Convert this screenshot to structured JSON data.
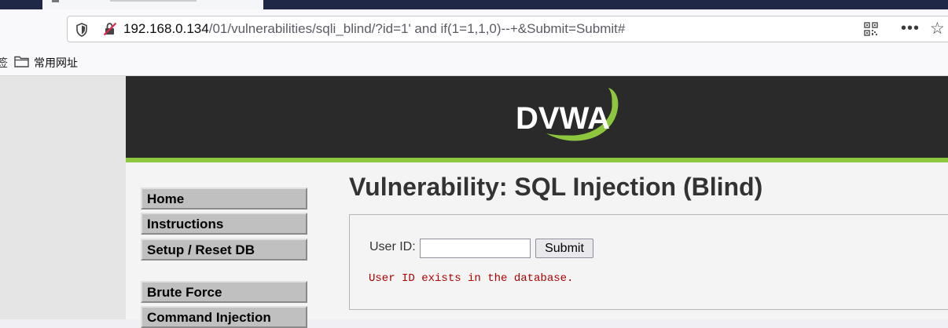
{
  "browser": {
    "url_host": "192.168.0.134",
    "url_path": "/01/vulnerabilities/sqli_blind/?id=1' and if(1=1,1,0)--+&Submit=Submit#",
    "more_glyph": "•••",
    "star_glyph": "☆",
    "icons": [
      "shield-icon",
      "insecure-lock-icon",
      "qr-code-icon",
      "more-icon",
      "star-icon",
      "folder-icon"
    ]
  },
  "bookmarks": {
    "left_fragment": "签",
    "folder_label": "常用网址"
  },
  "header": {
    "logo_text": "DVWA",
    "accent_color": "#8dc63f"
  },
  "menu": {
    "items": [
      "Home",
      "Instructions",
      "Setup / Reset DB",
      "Brute Force",
      "Command Injection"
    ]
  },
  "main": {
    "title": "Vulnerability: SQL Injection (Blind)",
    "form": {
      "label": "User ID:",
      "input_value": "",
      "submit_label": "Submit"
    },
    "result_text": "User ID exists in the database.",
    "result_color": "#aa0000"
  }
}
